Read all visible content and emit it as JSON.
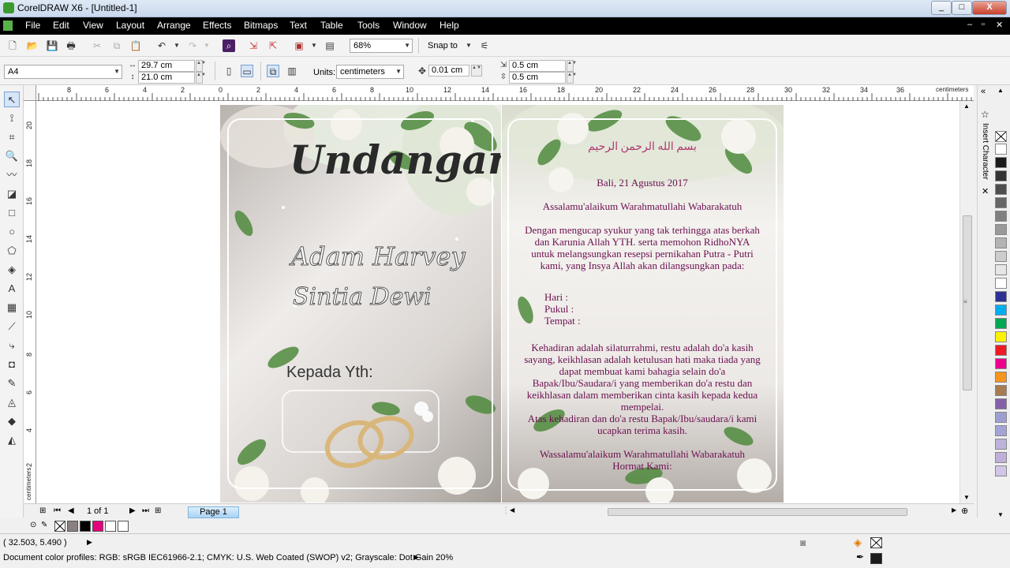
{
  "window": {
    "title": "CorelDRAW X6 - [Untitled-1]",
    "minimize": "_",
    "maximize": "□",
    "close": "X"
  },
  "menu": [
    "File",
    "Edit",
    "View",
    "Layout",
    "Arrange",
    "Effects",
    "Bitmaps",
    "Text",
    "Table",
    "Tools",
    "Window",
    "Help"
  ],
  "toolbar": {
    "zoom": "68%",
    "snap_to": "Snap to"
  },
  "propbar": {
    "paper_size": "A4",
    "width": "29.7 cm",
    "height": "21.0 cm",
    "units_label": "Units:",
    "units": "centimeters",
    "nudge": "0.01 cm",
    "dup_x": "0.5 cm",
    "dup_y": "0.5 cm"
  },
  "ruler": {
    "h_ticks": [
      "8",
      "6",
      "4",
      "2",
      "0",
      "2",
      "4",
      "6",
      "8",
      "10",
      "12",
      "14",
      "16",
      "18",
      "20",
      "22",
      "24",
      "26",
      "28",
      "30",
      "32",
      "34",
      "36"
    ],
    "v_ticks": [
      "20",
      "18",
      "16",
      "14",
      "12",
      "10",
      "8",
      "6",
      "4",
      "2"
    ],
    "unit": "centimeters"
  },
  "docker": {
    "tab_label": "Insert Character"
  },
  "palette_colors": [
    "#ffffff",
    "#1a1a1a",
    "#333333",
    "#4d4d4d",
    "#666666",
    "#808080",
    "#999999",
    "#b3b3b3",
    "#cccccc",
    "#e6e6e6",
    "#ffffff",
    "#2e3192",
    "#00aeef",
    "#00a651",
    "#fff200",
    "#ed1c24",
    "#ec008c",
    "#f7941d",
    "#a67c52",
    "#8560a8",
    "#9e9fd0",
    "#a3a3d6",
    "#bdb3da",
    "#c0b0d8",
    "#d1c6e5"
  ],
  "invitation": {
    "left": {
      "title": "Undangan",
      "name1": "Adam Harvey",
      "name2": "Sintia Dewi",
      "to": "Kepada Yth:"
    },
    "right": {
      "arabic": "بسم الله الرحمن الرحيم",
      "date": "Bali, 21 Agustus 2017",
      "greeting": "Assalamu'alaikum Warahmatullahi Wabarakatuh",
      "p1": "Dengan mengucap syukur yang tak terhingga atas berkah dan Karunia Allah YTH. serta memohon RidhoNYA untuk melangsungkan resepsi pernikahan Putra - Putri kami, yang Insya Allah akan dilangsungkan pada:",
      "day": "Hari      :",
      "time": "Pukul    :",
      "place": "Tempat  :",
      "p2": "Kehadiran adalah silaturrahmi, restu adalah do'a kasih sayang, keikhlasan adalah ketulusan hati maka tiada yang dapat membuat kami bahagia selain do'a Bapak/Ibu/Saudara/i yang memberikan do'a restu dan keikhlasan dalam memberikan cinta kasih kepada kedua mempelai.",
      "p3": "Atas kehadiran dan do'a restu Bapak/Ibu/saudara/i kami ucapkan terima kasih.",
      "closing": "Wassalamu'alaikum Warahmatullahi Wabarakatuh",
      "sign": "Hormat Kami:"
    }
  },
  "pagenav": {
    "counter": "1 of 1",
    "page_tab": "Page 1"
  },
  "status": {
    "coords": "( 32.503, 5.490 )",
    "profiles": "Document color profiles: RGB: sRGB IEC61966-2.1; CMYK: U.S. Web Coated (SWOP) v2; Grayscale: Dot Gain 20%"
  },
  "colors": {
    "menu_bg": "#000000",
    "invite_text": "#6b0f4f",
    "page_tab": "#a9d3f2"
  }
}
